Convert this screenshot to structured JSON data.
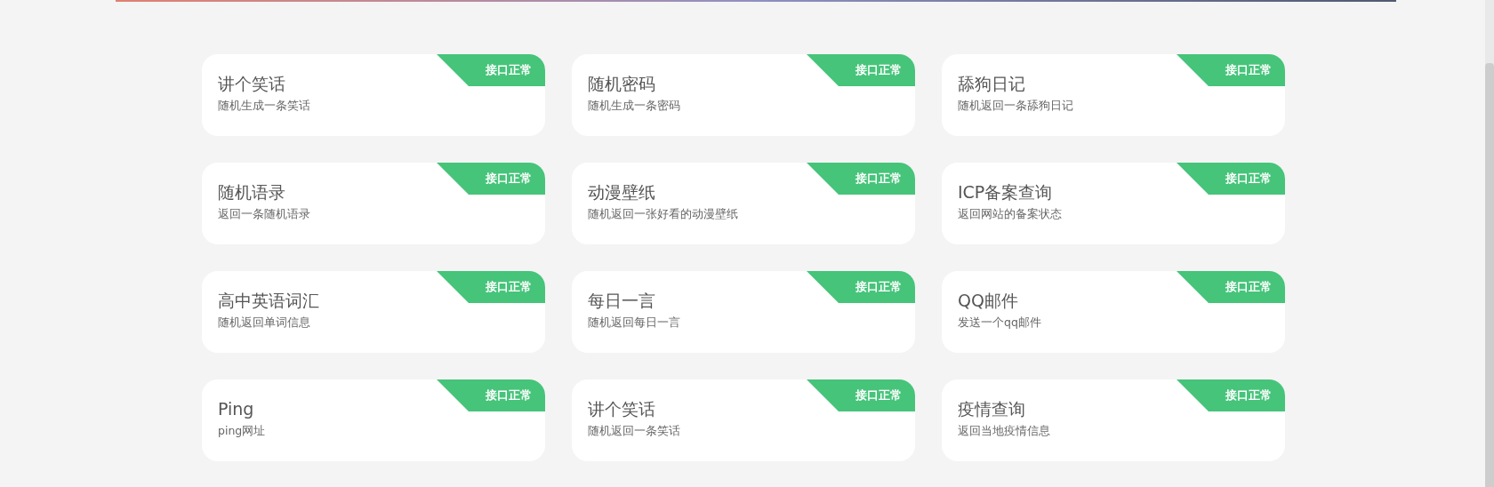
{
  "cards": [
    {
      "title": "讲个笑话",
      "description": "随机生成一条笑话",
      "status": "接口正常"
    },
    {
      "title": "随机密码",
      "description": "随机生成一条密码",
      "status": "接口正常"
    },
    {
      "title": "舔狗日记",
      "description": "随机返回一条舔狗日记",
      "status": "接口正常"
    },
    {
      "title": "随机语录",
      "description": "返回一条随机语录",
      "status": "接口正常"
    },
    {
      "title": "动漫壁纸",
      "description": "随机返回一张好看的动漫壁纸",
      "status": "接口正常"
    },
    {
      "title": "ICP备案查询",
      "description": "返回网站的备案状态",
      "status": "接口正常"
    },
    {
      "title": "高中英语词汇",
      "description": "随机返回单词信息",
      "status": "接口正常"
    },
    {
      "title": "每日一言",
      "description": "随机返回每日一言",
      "status": "接口正常"
    },
    {
      "title": "QQ邮件",
      "description": "发送一个qq邮件",
      "status": "接口正常"
    },
    {
      "title": "Ping",
      "description": "ping网址",
      "status": "接口正常"
    },
    {
      "title": "讲个笑话",
      "description": "随机返回一条笑话",
      "status": "接口正常"
    },
    {
      "title": "疫情查询",
      "description": "返回当地疫情信息",
      "status": "接口正常"
    }
  ]
}
